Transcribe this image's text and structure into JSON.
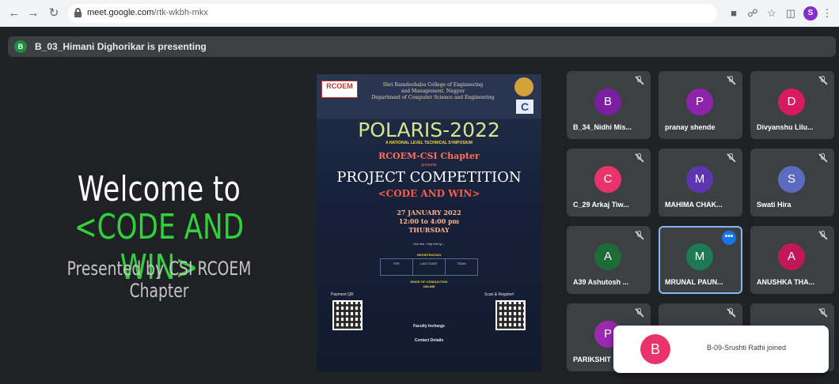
{
  "browser": {
    "url_host": "meet.google.com",
    "url_path": "/rtk-wkbh-mkx",
    "profile_initial": "S",
    "nav_icons": [
      "back-arrow-icon",
      "forward-arrow-icon",
      "reload-icon"
    ],
    "toolbar_icons": [
      "camera-icon",
      "share-icon",
      "star-icon",
      "sidepanel-icon",
      "menu-dots-icon"
    ]
  },
  "meet": {
    "presenter_initial": "B",
    "presenting_text": "B_03_Himani Dighorikar is presenting",
    "slide": {
      "line1": "Welcome to",
      "line2": "<CODE AND WIN>",
      "line3": "Presented by CSI RCOEM Chapter"
    },
    "poster": {
      "logo_text": "RCOEM",
      "college_lines": [
        "Shri Ramdeobaba College of Engineering",
        "and Management, Nagpur",
        "Department of Computer Science and Engineering"
      ],
      "csi_logo": "C",
      "event": "POLARIS-2022",
      "event_sub": "A NATIONAL LEVEL TECHNICAL SYMPOSIUM",
      "chapter": "RCOEM-CSI Chapter",
      "presents": "presents",
      "competition": "PROJECT COMPETITION",
      "tagline": "<CODE AND WIN>",
      "date": "27 JANUARY 2022",
      "time": "12:00 to 4:00 pm",
      "day": "THURSDAY",
      "link": "Use link : http://bit.ly/...",
      "registration_title": "REGISTRATION",
      "reg_fee": "FEE",
      "reg_last_date": "LAST DATE",
      "reg_team": "TEAM",
      "mode_title": "MODE OF CONDUCTION",
      "mode": "ONLINE",
      "payment_label": "Payment QR",
      "scan_label": "Scan & Register!",
      "faculty_title": "Faculty Incharge",
      "contact_title": "Contact Details"
    },
    "participants": [
      {
        "initial": "B",
        "name": "B_34_Nidhi Mis...",
        "color": "#7b1fa2"
      },
      {
        "initial": "P",
        "name": "pranay shende",
        "color": "#8e24aa"
      },
      {
        "initial": "D",
        "name": "Divyanshu Lilu...",
        "color": "#d81b60"
      },
      {
        "initial": "C",
        "name": "C_29 Arkaj Tiw...",
        "color": "#e8336d"
      },
      {
        "initial": "M",
        "name": "MAHIMA CHAK...",
        "color": "#5e35b1"
      },
      {
        "initial": "S",
        "name": "Swati Hira",
        "color": "#5c6bc0"
      },
      {
        "initial": "A",
        "name": "A39 Ashutosh ...",
        "color": "#1e6b3a"
      },
      {
        "initial": "M",
        "name": "MRUNAL PAUN...",
        "color": "#1e7a55"
      },
      {
        "initial": "A",
        "name": "ANUSHKA THA...",
        "color": "#c2185b"
      },
      {
        "initial": "P",
        "name": "PARIKSHIT",
        "color": "#9c27b0"
      }
    ],
    "tile_more": "•••",
    "toast": {
      "initial": "B",
      "text": "B-09-Srushti Rathi joined"
    }
  }
}
